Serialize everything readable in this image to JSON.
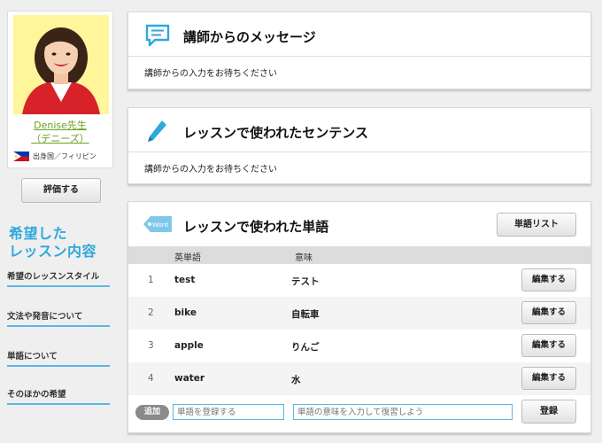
{
  "tutor": {
    "name": "Denise先生",
    "kana": "（デニーズ）",
    "origin": "出身国／フィリピン",
    "rate_label": "評価する"
  },
  "wish": {
    "title_line1": "希望した",
    "title_line2": "レッスン内容",
    "items": [
      {
        "label": "希望のレッスンスタイル"
      },
      {
        "label": "文法や発音について"
      },
      {
        "label": "単語について"
      },
      {
        "label": "そのほかの希望"
      }
    ]
  },
  "message_panel": {
    "title": "講師からのメッセージ",
    "body": "講師からの入力をお待ちください"
  },
  "sentence_panel": {
    "title": "レッスンで使われたセンテンス",
    "body": "講師からの入力をお待ちください"
  },
  "word_panel": {
    "title": "レッスンで使われた単語",
    "tag_label": "Word",
    "list_button": "単語リスト",
    "col_en": "英単語",
    "col_ja": "意味",
    "edit_label": "編集する",
    "rows": [
      {
        "num": "1",
        "en": "test",
        "ja": "テスト"
      },
      {
        "num": "2",
        "en": "bike",
        "ja": "自転車"
      },
      {
        "num": "3",
        "en": "apple",
        "ja": "りんご"
      },
      {
        "num": "4",
        "en": "water",
        "ja": "水"
      }
    ],
    "add_badge": "追加",
    "word_placeholder": "単語を登録する",
    "meaning_placeholder": "単語の意味を入力して復習しよう",
    "register_label": "登録"
  },
  "colors": {
    "accent": "#2fa8dc",
    "underline": "#5ab7e6",
    "name_green": "#6aa121",
    "photo_bg": "#fff59a"
  }
}
